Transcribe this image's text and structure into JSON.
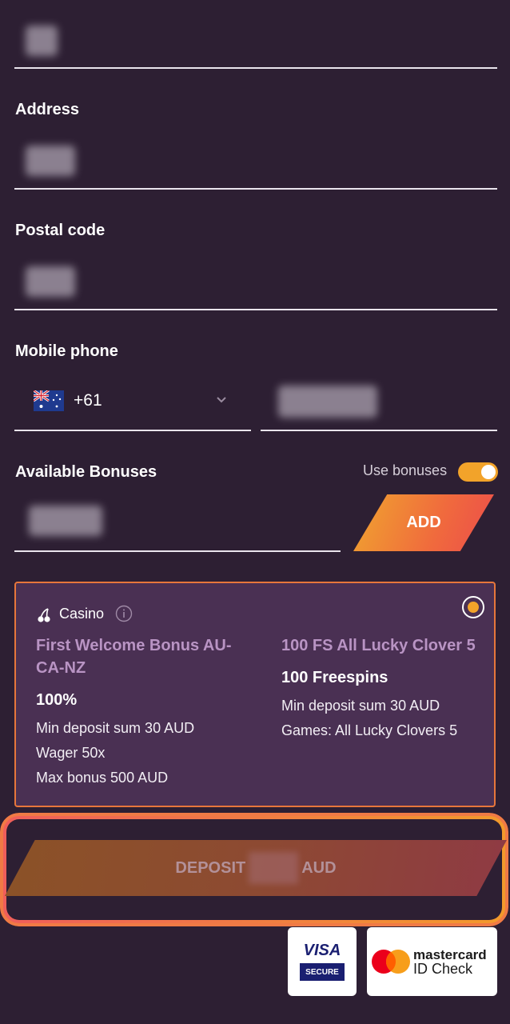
{
  "form": {
    "address_label": "Address",
    "postal_label": "Postal code",
    "mobile_label": "Mobile phone",
    "dial_code": "+61",
    "bonuses_label": "Available Bonuses",
    "use_bonuses_label": "Use bonuses",
    "use_bonuses_on": true,
    "add_button_label": "ADD"
  },
  "bonus_card": {
    "category": "Casino",
    "selected": true,
    "offers": [
      {
        "title": "First Welcome Bonus AU-CA-NZ",
        "amount": "100%",
        "lines": [
          "Min deposit sum 30 AUD",
          "Wager 50x",
          "Max bonus 500 AUD"
        ]
      },
      {
        "title": "100 FS All Lucky Clover 5",
        "amount": "100 Freespins",
        "lines": [
          "Min deposit sum 30 AUD",
          "Games: All Lucky Clovers 5"
        ]
      }
    ]
  },
  "deposit": {
    "prefix": "DEPOSIT",
    "currency": "AUD"
  },
  "payment": {
    "visa_word": "VISA",
    "visa_secure": "SECURE",
    "mc_word": "mastercard",
    "mc_sub": "ID Check"
  },
  "colors": {
    "background": "#2d1f33",
    "accent": "#f2a32a",
    "card_bg": "#4a3053",
    "card_border": "#e7763b",
    "offer_title": "#b994c4"
  },
  "icons": [
    "cherry-icon",
    "info-icon",
    "chevron-down-icon",
    "australia-flag-icon"
  ]
}
